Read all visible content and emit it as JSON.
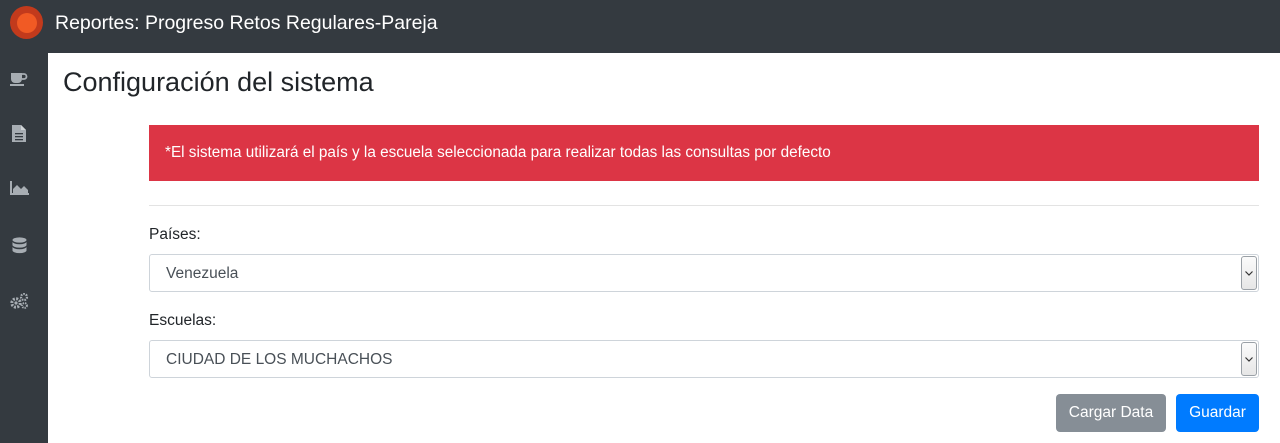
{
  "header": {
    "logo_icon": "brand-logo-circle",
    "title": "Reportes: Progreso Retos Regulares-Pareja"
  },
  "sidebar": {
    "items": [
      {
        "icon": "coffee-icon"
      },
      {
        "icon": "document-icon"
      },
      {
        "icon": "area-chart-icon"
      },
      {
        "icon": "database-icon"
      },
      {
        "icon": "gears-icon"
      }
    ]
  },
  "main": {
    "page_title": "Configuración del sistema",
    "alert_text": "*El sistema utilizará el país y la escuela seleccionada para realizar todas las consultas por defecto",
    "country": {
      "label": "Países:",
      "selected": "Venezuela"
    },
    "school": {
      "label": "Escuelas:",
      "selected": "CIUDAD DE LOS MUCHACHOS"
    },
    "buttons": {
      "load_data": "Cargar Data",
      "save": "Guardar"
    }
  },
  "colors": {
    "topbar": "#343a40",
    "alert_danger": "#dc3545",
    "primary": "#007bff",
    "secondary": "#868e96"
  }
}
